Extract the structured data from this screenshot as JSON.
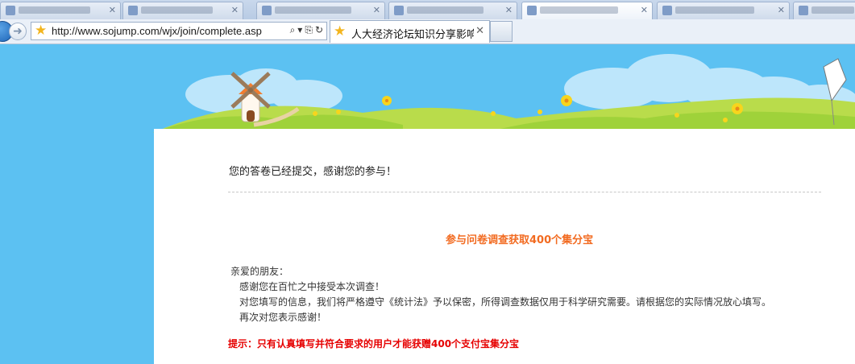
{
  "browser": {
    "url": "http://www.sojump.com/wjx/join/complete.asp",
    "active_tab_title": "人大经济论坛知识分享影响...",
    "tab_close_glyph": "✕",
    "search_glyph": "⌕",
    "dropdown_glyph": "▾",
    "compat_glyph": "⎘",
    "refresh_glyph": "↻",
    "forward_glyph": "➜",
    "favorite_icon": "star-icon"
  },
  "content": {
    "submitted_message": "您的答卷已经提交，感谢您的参与！",
    "promo_title": "参与问卷调查获取400个集分宝",
    "greeting": "亲爱的朋友：",
    "line1": "感谢您在百忙之中接受本次调查！",
    "line2": "对您填写的信息，我们将严格遵守《统计法》予以保密，所得调查数据仅用于科学研究需要。请根据您的实际情况放心填写。",
    "line3": "再次对您表示感谢！",
    "tip": "提示：只有认真填写并符合要求的用户才能获赠400个支付宝集分宝"
  },
  "colors": {
    "sky": "#5cc1f2",
    "grass": "#9fd23a",
    "promo": "#f26b21",
    "tip": "#e60000"
  }
}
